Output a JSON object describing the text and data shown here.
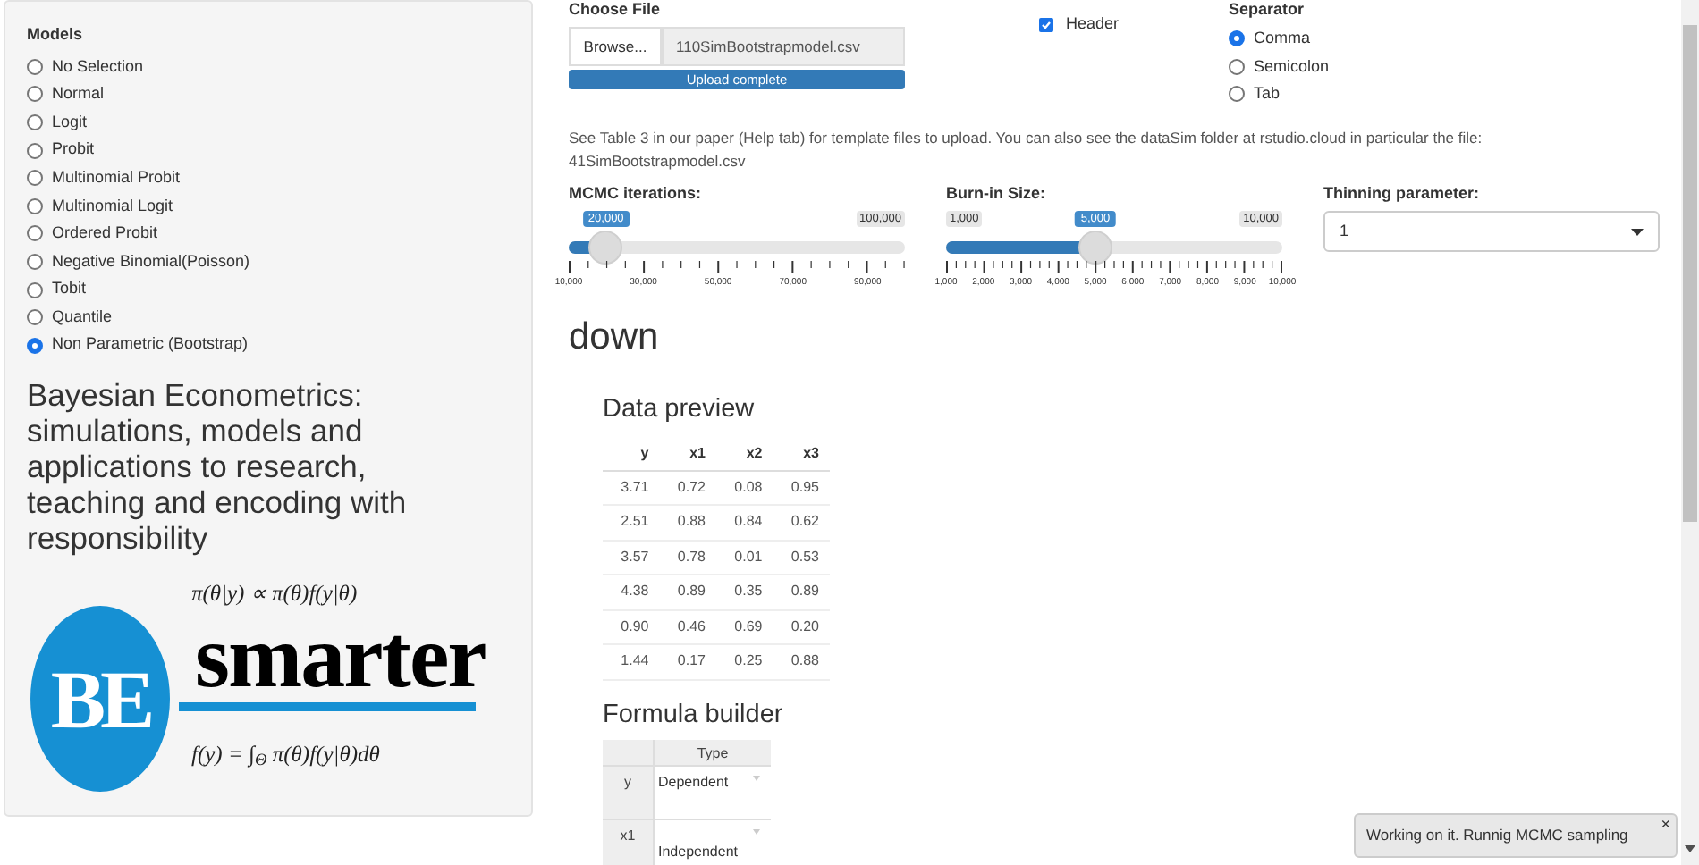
{
  "sidebar": {
    "models_label": "Models",
    "models": [
      {
        "label": "No Selection",
        "selected": false
      },
      {
        "label": "Normal",
        "selected": false
      },
      {
        "label": "Logit",
        "selected": false
      },
      {
        "label": "Probit",
        "selected": false
      },
      {
        "label": "Multinomial Probit",
        "selected": false
      },
      {
        "label": "Multinomial Logit",
        "selected": false
      },
      {
        "label": "Ordered Probit",
        "selected": false
      },
      {
        "label": "Negative Binomial(Poisson)",
        "selected": false
      },
      {
        "label": "Tobit",
        "selected": false
      },
      {
        "label": "Quantile",
        "selected": false
      },
      {
        "label": "Non Parametric (Bootstrap)",
        "selected": true
      }
    ],
    "title": "Bayesian Econometrics: simulations, models and applications to research, teaching and encoding with responsibility",
    "logo": {
      "formula_top": "π(θ|y) ∝ π(θ)f(y|θ)",
      "letters": "BE",
      "word": "smarter",
      "formula_bottom": "f(y) = ∫$_{Θ}$ π(θ)f(y|θ)dθ"
    }
  },
  "file_input": {
    "label": "Choose File",
    "button": "Browse...",
    "file_name": "110SimBootstrapmodel.csv",
    "progress": {
      "text": "Upload complete",
      "level": 1
    }
  },
  "header_checkbox": {
    "label": "Header",
    "checked": true
  },
  "separator": {
    "label": "Separator",
    "options": [
      {
        "label": "Comma",
        "selected": true
      },
      {
        "label": "Semicolon",
        "selected": false
      },
      {
        "label": "Tab",
        "selected": false
      }
    ]
  },
  "help_text": "See Table 3 in our paper (Help tab) for template files to upload. You can also see the dataSim folder at rstudio.cloud in particular the file: 41SimBootstrapmodel.csv",
  "sliders": [
    {
      "label": "MCMC iterations:",
      "max_label": "100,000",
      "value_label": "20,000",
      "level": 0.111,
      "ticks": [
        "10,000",
        "30,000",
        "50,000",
        "70,000",
        "90,000"
      ]
    },
    {
      "label": "Burn-in Size:",
      "min_label": "1,000",
      "max_label": "10,000",
      "value_label": "5,000",
      "level": 0.444,
      "ticks": [
        "1,000",
        "2,000",
        "3,000",
        "4,000",
        "5,000",
        "6,000",
        "7,000",
        "8,000",
        "9,000",
        "10,000"
      ]
    }
  ],
  "thinning": {
    "label": "Thinning parameter:",
    "value": "1"
  },
  "output_heading": "down",
  "data_preview": {
    "heading": "Data preview",
    "columns": [
      "y",
      "x1",
      "x2",
      "x3"
    ],
    "rows": [
      [
        "3.71",
        "0.72",
        "0.08",
        "0.95"
      ],
      [
        "2.51",
        "0.88",
        "0.84",
        "0.62"
      ],
      [
        "3.57",
        "0.78",
        "0.01",
        "0.53"
      ],
      [
        "4.38",
        "0.89",
        "0.35",
        "0.89"
      ],
      [
        "0.90",
        "0.46",
        "0.69",
        "0.20"
      ],
      [
        "1.44",
        "0.17",
        "0.25",
        "0.88"
      ]
    ]
  },
  "formula_builder": {
    "heading": "Formula builder",
    "columns": [
      "Type"
    ],
    "rows": [
      {
        "variable": "y",
        "type": "Dependent"
      },
      {
        "variable": "x1",
        "type": "Independent"
      }
    ]
  },
  "notification": {
    "text": "Working on it. Runnig MCMC sampling",
    "close": "×"
  }
}
